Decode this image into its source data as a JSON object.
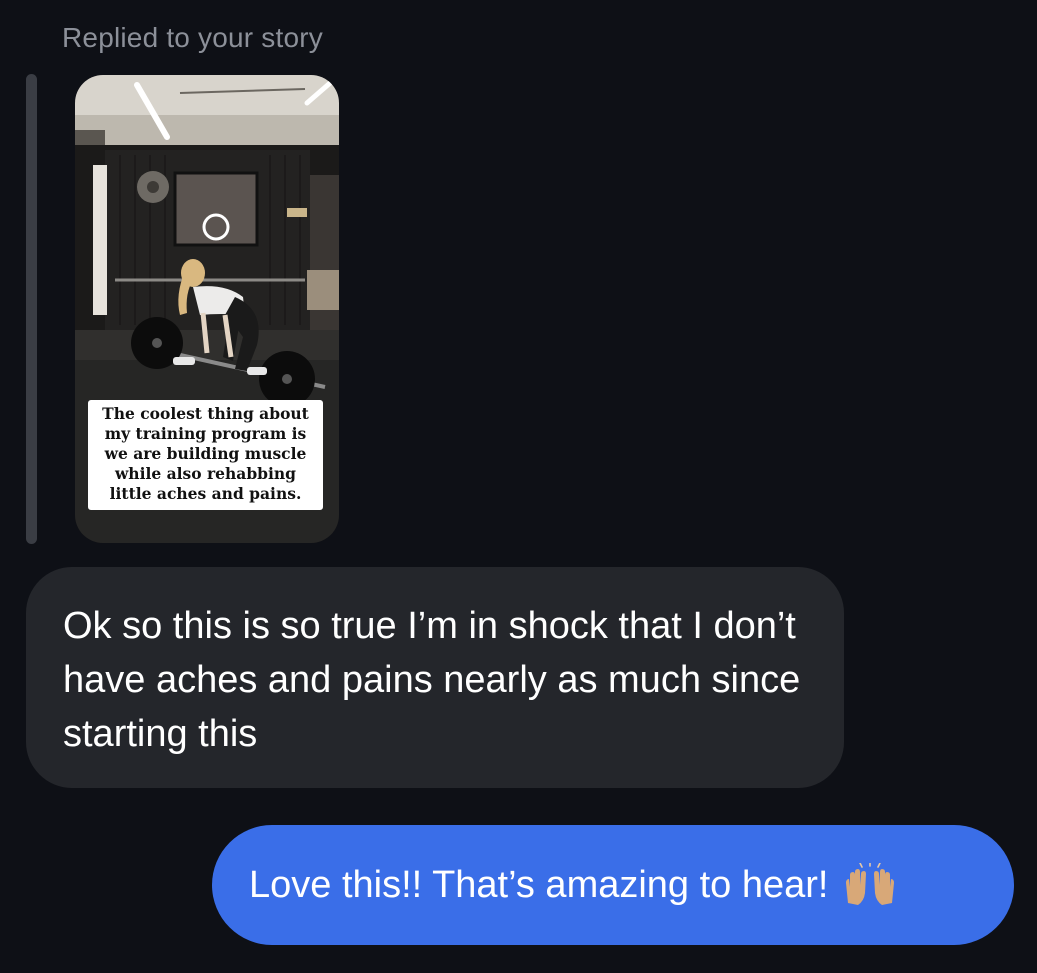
{
  "thread": {
    "reply_label": "Replied to your story",
    "story": {
      "caption": "The coolest thing about my training program is we are building muscle while also rehabbing little aches and pains."
    },
    "incoming_message": {
      "text": "Ok so this is so true I’m in shock that I don’t have aches and pains nearly as much since starting this"
    },
    "outgoing_message": {
      "text": "Love this!! That’s amazing to hear!",
      "emoji": "raising-hands-icon"
    }
  },
  "colors": {
    "background": "#0e1016",
    "incoming_bubble": "#24262b",
    "outgoing_bubble": "#3a6ee8",
    "muted_text": "#8c9099"
  }
}
